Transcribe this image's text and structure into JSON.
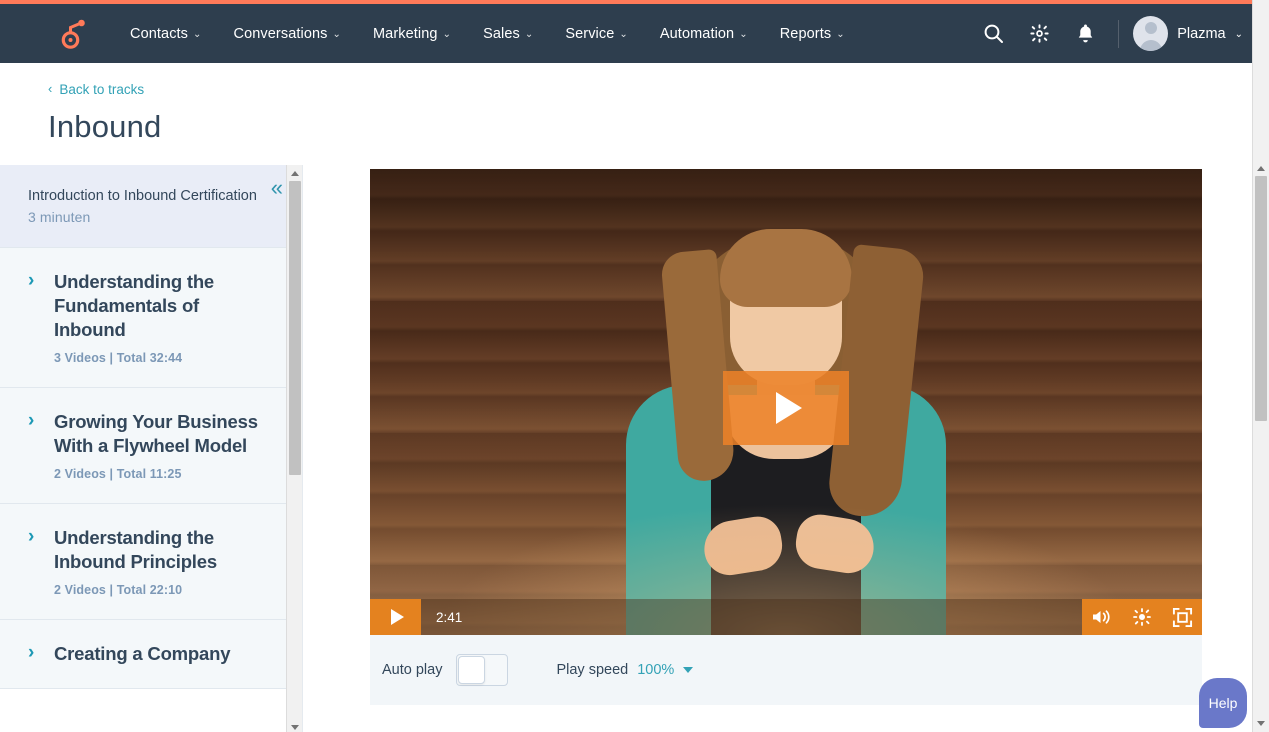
{
  "topnav": {
    "logo": "hubspot-sprocket-logo",
    "items": [
      {
        "label": "Contacts",
        "caret": "⌄"
      },
      {
        "label": "Conversations",
        "caret": "⌄"
      },
      {
        "label": "Marketing",
        "caret": "⌄"
      },
      {
        "label": "Sales",
        "caret": "⌄"
      },
      {
        "label": "Service",
        "caret": "⌄"
      },
      {
        "label": "Automation",
        "caret": "⌄"
      },
      {
        "label": "Reports",
        "caret": "⌄"
      }
    ],
    "icons": [
      "search-icon",
      "gear-icon",
      "bell-icon"
    ],
    "account_name": "Plazma",
    "account_caret": "⌄",
    "bar_color": "#2e3e4e",
    "accent_color": "#ff7a59"
  },
  "header": {
    "back_chevron": "‹",
    "back_label": "Back to tracks",
    "title": "Inbound",
    "link_color": "#33a2b6"
  },
  "sidebar": {
    "collapse_icon": "«",
    "items": [
      {
        "title": "Introduction to Inbound Certification",
        "subtitle": "3 minuten",
        "active": true,
        "chevron": ""
      },
      {
        "title": "Understanding the Fundamentals of Inbound",
        "subtitle": "3 Videos | Total 32:44",
        "active": false,
        "chevron": "›"
      },
      {
        "title": "Growing Your Business With a Flywheel Model",
        "subtitle": "2 Videos | Total 11:25",
        "active": false,
        "chevron": "›"
      },
      {
        "title": "Understanding the Inbound Principles",
        "subtitle": "2 Videos | Total 22:10",
        "active": false,
        "chevron": "›"
      },
      {
        "title": "Creating a Company",
        "subtitle": "",
        "active": false,
        "chevron": "›"
      }
    ]
  },
  "player": {
    "overlay_play_icon": "play-triangle",
    "current_time": "2:41",
    "play_button_icon": "play-icon",
    "volume_icon": "volume-icon",
    "settings_icon": "gear-icon",
    "fullscreen_icon": "fullscreen-icon",
    "accent_color": "#e4821f"
  },
  "controls_bar": {
    "autoplay_label": "Auto play",
    "autoplay_on": false,
    "play_speed_label": "Play speed",
    "play_speed_value": "100%",
    "play_speed_caret": "▾"
  },
  "help": {
    "label": "Help",
    "color": "#6a78c9"
  }
}
